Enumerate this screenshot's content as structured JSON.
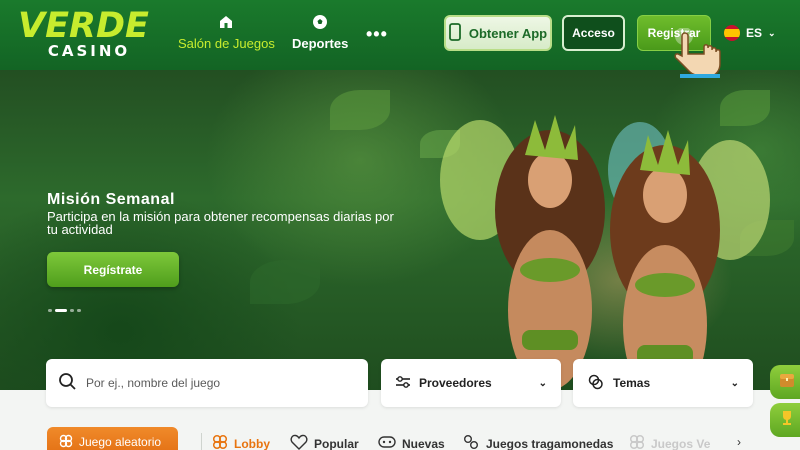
{
  "brand": {
    "name": "VERDE",
    "tagline": "CASINO"
  },
  "nav": {
    "items": [
      {
        "label": "Salón de Juegos",
        "icon": "home-icon"
      },
      {
        "label": "Deportes",
        "icon": "soccer-ball-icon"
      }
    ],
    "more_label": "•••"
  },
  "header_actions": {
    "app_label": "Obtener App",
    "login_label": "Acceso",
    "register_label": "Registrar",
    "language": "ES"
  },
  "banner": {
    "title": "Misión Semanal",
    "text": "Participa en la misión para obtener recompensas diarias por tu actividad",
    "cta_label": "Regístrate"
  },
  "search": {
    "placeholder": "Por ej., nombre del juego"
  },
  "filters": {
    "providers_label": "Proveedores",
    "themes_label": "Temas"
  },
  "categories": {
    "random_label": "Juego aleatorio",
    "items": [
      {
        "label": "Lobby",
        "active": true
      },
      {
        "label": "Popular",
        "active": false
      },
      {
        "label": "Nuevas",
        "active": false
      },
      {
        "label": "Juegos tragamonedas",
        "active": false
      },
      {
        "label": "Juegos Ve",
        "active": false
      }
    ]
  },
  "colors": {
    "header_green": "#1a7a2c",
    "accent_lime": "#c7ec2e",
    "orange": "#e8740f"
  }
}
